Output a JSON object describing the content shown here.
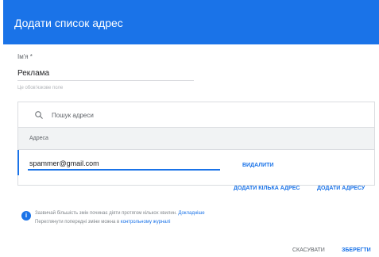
{
  "dialog": {
    "title": "Додати список адрес"
  },
  "name_field": {
    "label": "Ім'я *",
    "value": "Реклама",
    "hint": "Це обов'язкове поле"
  },
  "search": {
    "placeholder": "Пошук адреси"
  },
  "table": {
    "column_header": "Адреса",
    "rows": [
      {
        "address": "spammer@gmail.com",
        "delete_label": "ВИДАЛИТИ"
      }
    ]
  },
  "actions": {
    "add_bulk": "ДОДАТИ КІЛЬКА АДРЕС",
    "add_one": "ДОДАТИ АДРЕСУ"
  },
  "info": {
    "line1_text": "Зазвичай більшість змін починає діяти протягом кількох хвилин.",
    "line1_link": "Докладніше",
    "line2_text": "Переглянути попередні зміни можна в",
    "line2_link": "контрольному журналі"
  },
  "footer": {
    "cancel": "СКАСУВАТИ",
    "save": "ЗБЕРЕГТИ"
  },
  "colors": {
    "accent": "#1a73e8"
  },
  "icons": {
    "search": "search-icon",
    "info": "info-icon"
  }
}
